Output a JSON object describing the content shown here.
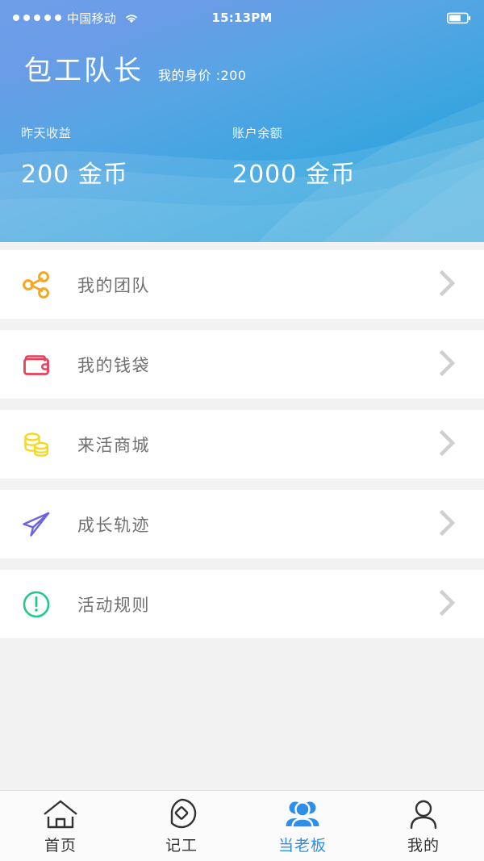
{
  "statusbar": {
    "signal_dots": 5,
    "carrier": "中国移动",
    "wifi_icon": "wifi-icon",
    "time": "15:13PM",
    "battery_icon": "battery-icon",
    "battery_level_pct": 60
  },
  "header": {
    "title": "包工队长",
    "subtitle": "我的身价 :200",
    "gradient_from": "#6f9ee8",
    "gradient_to": "#23a0da",
    "stats": [
      {
        "label": "昨天收益",
        "value": "200 金币"
      },
      {
        "label": "账户余额",
        "value": "2000 金币"
      }
    ]
  },
  "menu": {
    "items": [
      {
        "label": "我的团队",
        "icon": "share-nodes-icon",
        "color": "#F5A623",
        "chevron": "chevron-right-icon"
      },
      {
        "label": "我的钱袋",
        "icon": "wallet-icon",
        "color": "#E6405A",
        "chevron": "chevron-right-icon"
      },
      {
        "label": "来活商城",
        "icon": "coins-stack-icon",
        "color": "#F6D81E",
        "chevron": "chevron-right-icon"
      },
      {
        "label": "成长轨迹",
        "icon": "paper-plane-icon",
        "color": "#6B63E0",
        "chevron": "chevron-right-icon"
      },
      {
        "label": "活动规则",
        "icon": "exclamation-circle-icon",
        "color": "#22C98C",
        "chevron": "chevron-right-icon"
      }
    ]
  },
  "tabbar": {
    "active_color": "#2f8fe8",
    "inactive_color": "#333333",
    "items": [
      {
        "label": "首页",
        "icon": "home-icon",
        "active": false
      },
      {
        "label": "记工",
        "icon": "tag-diamond-icon",
        "active": false
      },
      {
        "label": "当老板",
        "icon": "group-users-icon",
        "active": true
      },
      {
        "label": "我的",
        "icon": "person-icon",
        "active": false
      }
    ]
  }
}
